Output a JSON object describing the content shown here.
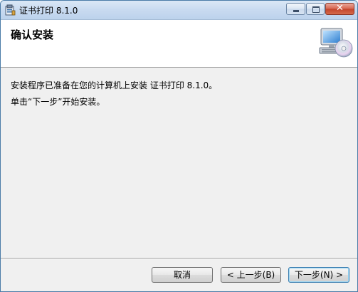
{
  "window": {
    "title": "证书打印 8.1.0",
    "minimize_icon": "minimize-icon",
    "maximize_icon": "maximize-icon",
    "close_icon": "close-icon",
    "close_glyph": "✕"
  },
  "header": {
    "title": "确认安装",
    "icon": "computer-cd-icon"
  },
  "body": {
    "line1": "安装程序已准备在您的计算机上安装 证书打印 8.1.0。",
    "line2": "单击“下一步”开始安装。"
  },
  "buttons": {
    "cancel": "取消",
    "back": "< 上一步(B)",
    "next": "下一步(N) >"
  },
  "colors": {
    "titlebar": "#c8daf0",
    "close_button": "#c3442b",
    "dialog_background": "#f0f0f0",
    "default_button_border": "#3c7fb1"
  }
}
